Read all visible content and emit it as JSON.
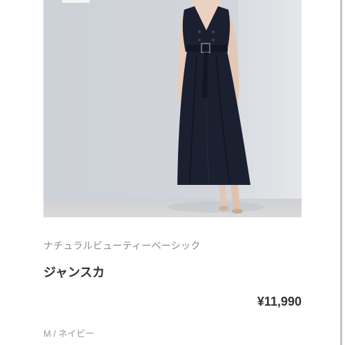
{
  "product": {
    "brand": "ナチュラルビューティーベーシック",
    "name": "ジャンスカ",
    "price": "¥11,990",
    "variant": "M / ネイビー"
  },
  "colors": {
    "text_primary": "#333333",
    "text_secondary": "#8c8c8c",
    "dress": "#1b2030",
    "background": "#ffffff"
  }
}
